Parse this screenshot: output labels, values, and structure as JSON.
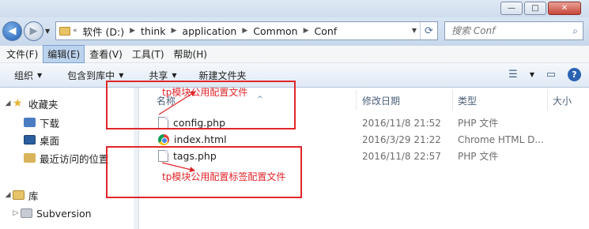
{
  "window": {
    "minimize": "—",
    "maximize": "□",
    "close": "✕"
  },
  "address": {
    "overflow": "«",
    "crumbs": [
      "软件 (D:)",
      "think",
      "application",
      "Common",
      "Conf"
    ],
    "search_placeholder": "搜索 Conf"
  },
  "menu": [
    "文件(F)",
    "编辑(E)",
    "查看(V)",
    "工具(T)",
    "帮助(H)"
  ],
  "toolbar": {
    "organize": "组织",
    "include_library": "包含到库中",
    "share": "共享",
    "new_folder": "新建文件夹"
  },
  "nav": {
    "favorites": "收藏夹",
    "downloads": "下载",
    "desktop": "桌面",
    "recent": "最近访问的位置",
    "libraries": "库",
    "subversion": "Subversion"
  },
  "columns": {
    "name": "名称",
    "modified": "修改日期",
    "type": "类型",
    "size": "大小"
  },
  "files": [
    {
      "name": "config.php",
      "modified": "2016/11/8 21:52",
      "type": "PHP 文件",
      "icon": "file-icon"
    },
    {
      "name": "index.html",
      "modified": "2016/3/29 21:22",
      "type": "Chrome HTML D...",
      "icon": "chrome-icon"
    },
    {
      "name": "tags.php",
      "modified": "2016/11/8 22:57",
      "type": "PHP 文件",
      "icon": "file-icon"
    }
  ],
  "annotations": {
    "config_note": "tp模块公用配置文件",
    "tags_note": "tp模块公用配置标签配置文件",
    "color": "#e2262a"
  }
}
